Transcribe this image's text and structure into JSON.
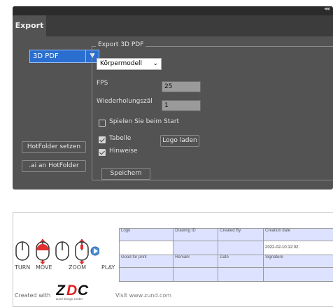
{
  "export_panel": {
    "tab_label": "Export",
    "format_select": {
      "value": "3D PDF"
    },
    "hotfolder_button": "HotFolder setzen",
    "ai_hotfolder_button": ".ai an HotFolder",
    "group": {
      "legend": "Export 3D PDF",
      "model_select": {
        "value": "Körpermodell"
      },
      "fps": {
        "label": "FPS",
        "value": "25"
      },
      "repeat": {
        "label": "Wiederholungszäl",
        "value": "1"
      },
      "play_on_start": {
        "label": "Spielen Sie beim Start",
        "checked": false
      },
      "table": {
        "label": "Tabelle",
        "checked": true
      },
      "hints": {
        "label": "Hinweise",
        "checked": true
      },
      "load_logo_button": "Logo laden",
      "save_button": "Speichern"
    }
  },
  "preview": {
    "nav": {
      "turn": "TURN",
      "move": "MOVE",
      "zoom": "ZOOM",
      "play": "PLAY",
      "accent_red": "#e03030",
      "accent_blue": "#4a8fd8"
    },
    "table": {
      "headers_row1": [
        "Logo",
        "Drawing ID",
        "Created By",
        "Creation date"
      ],
      "values_row1": [
        "",
        "",
        "",
        "2022-02-10.12:02:"
      ],
      "headers_row2": [
        "Good for print",
        "Remark",
        "Date",
        "Signature"
      ],
      "values_row2": [
        "",
        "",
        "",
        ""
      ],
      "header_color": "#dde3ff"
    },
    "footer": {
      "created_with": "Created with",
      "logo_text": "ZDC",
      "logo_tagline": "zund design center",
      "visit": "Visit www.zund.com"
    }
  }
}
